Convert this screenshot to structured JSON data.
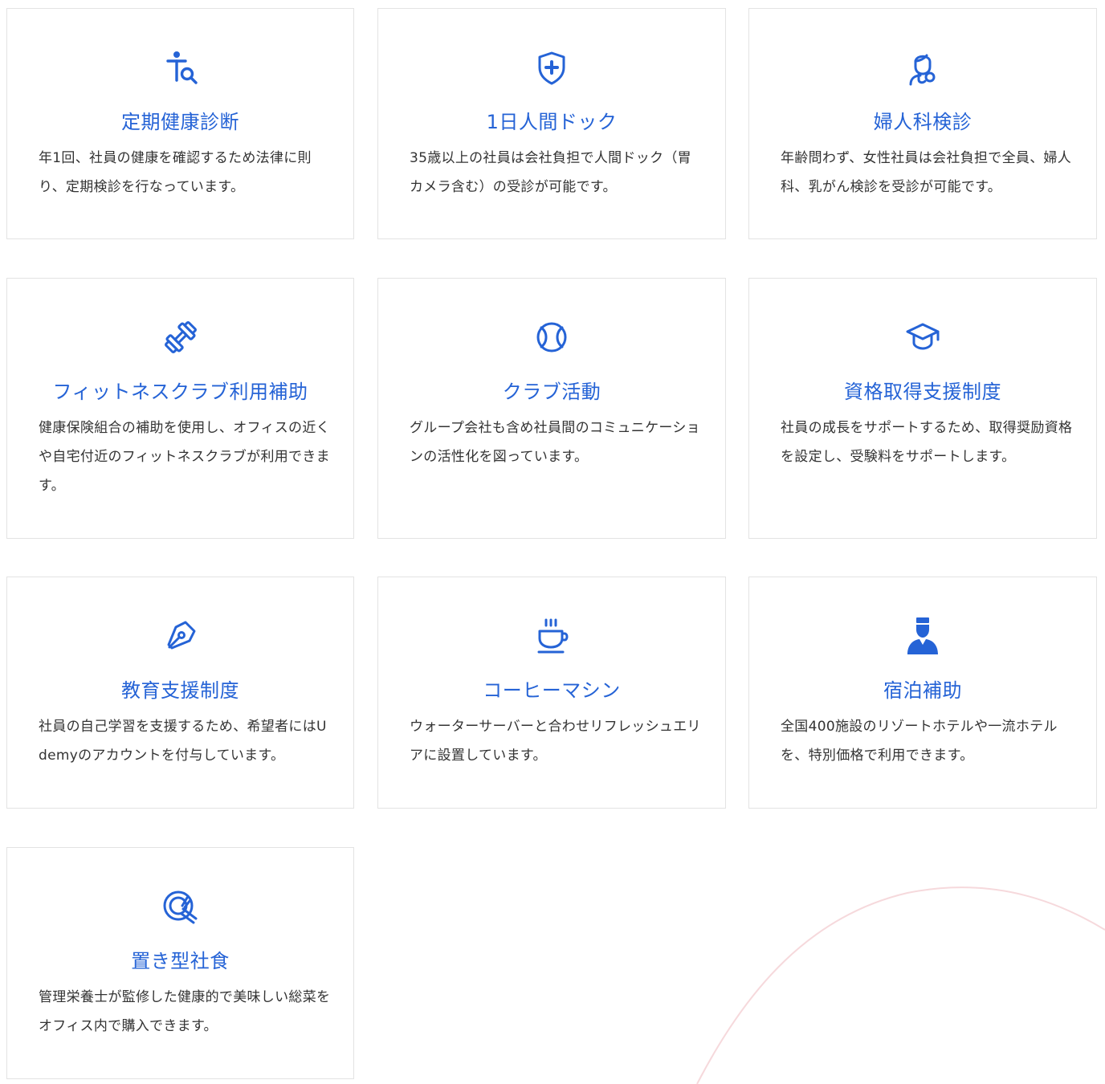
{
  "theme": {
    "accent": "#2563d6",
    "text": "#333333",
    "border": "#e3e3e3",
    "decor_curve": "#f6d9dc"
  },
  "cards": [
    {
      "icon": "person-search-icon",
      "title": "定期健康診断",
      "desc": "年1回、社員の健康を確認するため法律に則り、定期検診を行なっています。"
    },
    {
      "icon": "shield-plus-icon",
      "title": "1日人間ドック",
      "desc": "35歳以上の社員は会社負担で人間ドック（胃カメラ含む）の受診が可能です。"
    },
    {
      "icon": "woman-stethoscope-icon",
      "title": "婦人科検診",
      "desc": "年齢問わず、女性社員は会社負担で全員、婦人科、乳がん検診を受診が可能です。"
    },
    {
      "icon": "dumbbell-icon",
      "title": "フィットネスクラブ利用補助",
      "desc": "健康保険組合の補助を使用し、オフィスの近くや自宅付近のフィットネスクラブが利用できます。"
    },
    {
      "icon": "tennis-ball-icon",
      "title": "クラブ活動",
      "desc": "グループ会社も含め社員間のコミュニケーションの活性化を図っています。"
    },
    {
      "icon": "graduation-cap-icon",
      "title": "資格取得支援制度",
      "desc": "社員の成長をサポートするため、取得奨励資格を設定し、受験料をサポートします。"
    },
    {
      "icon": "pen-nib-icon",
      "title": "教育支援制度",
      "desc": "社員の自己学習を支援するため、希望者にはUdemyのアカウントを付与しています。"
    },
    {
      "icon": "coffee-cup-icon",
      "title": "コーヒーマシン",
      "desc": "ウォーターサーバーと合わせリフレッシュエリアに設置しています。"
    },
    {
      "icon": "bellhop-icon",
      "title": "宿泊補助",
      "desc": "全国400施設のリゾートホテルや一流ホテルを、特別価格で利用できます。"
    },
    {
      "icon": "plate-fork-knife-icon",
      "title": "置き型社食",
      "desc": "管理栄養士が監修した健康的で美味しい総菜をオフィス内で購入できます。"
    }
  ]
}
